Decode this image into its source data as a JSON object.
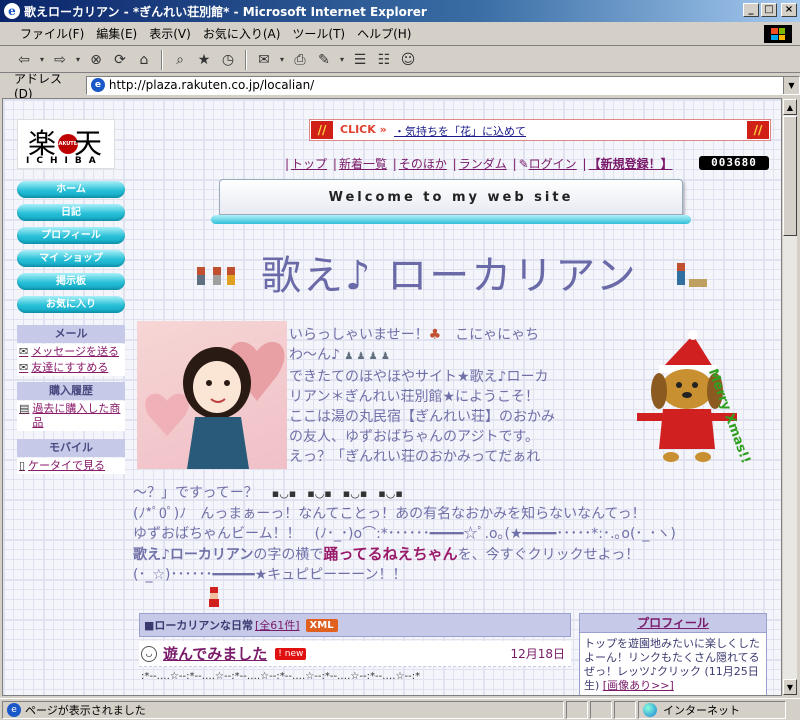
{
  "window": {
    "title": "歌えローカリアン - *ぎんれい荘別館* - Microsoft Internet Explorer"
  },
  "menubar": [
    "ファイル(F)",
    "編集(E)",
    "表示(V)",
    "お気に入り(A)",
    "ツール(T)",
    "ヘルプ(H)"
  ],
  "toolbar": {
    "icons": [
      "back-icon",
      "forward-icon",
      "stop-icon",
      "refresh-icon",
      "home-icon",
      "search-icon",
      "favorites-icon",
      "history-icon",
      "mail-icon",
      "print-icon",
      "edit-icon",
      "discuss-icon",
      "messenger-icon"
    ]
  },
  "address": {
    "label": "アドレス(D)",
    "url": "http://plaza.rakuten.co.jp/localian/"
  },
  "status": {
    "text": "ページが表示されました",
    "zone": "インターネット"
  },
  "page": {
    "logo": {
      "left": "楽",
      "right": "天",
      "dot": "RAKUTEN",
      "sub": "ICHIBA"
    },
    "nav_buttons": [
      "ホーム",
      "日記",
      "プロフィール",
      "マイ ショップ",
      "掲示板",
      "お気に入り"
    ],
    "sidebar": {
      "mail_head": "メール",
      "mail_links": [
        "メッセージを送る",
        "友達にすすめる"
      ],
      "history_head": "購入履歴",
      "history_link": "過去に購入した商品",
      "mobile_head": "モバイル",
      "mobile_link": "ケータイで見る"
    },
    "click_banner": {
      "label": "CLICK »",
      "link": "・気持ちを「花」に込めて"
    },
    "topnav": {
      "items": [
        "トップ",
        "新着一覧",
        "そのほか",
        "ランダム"
      ],
      "login": "ログイン",
      "register": "【新規登録！】",
      "counter": "003680"
    },
    "welcome": "Welcome to my web site",
    "main_title": "歌え♪ ローカリアン",
    "intro_top": [
      "いらっしゃいませー！",
      "こにゃにゃち",
      "わ～ん♪",
      "できたてのほやほやサイト★歌え♪ローカ",
      "リアン＊ぎんれい荘別館★にようこそ！",
      "ここは湯の丸民宿【ぎんれい荘】のおかみ",
      "の友人、ゆずおばちゃんのアジトです。",
      "えっ？「ぎんれい荘のおかみってだぁれ"
    ],
    "intro_bottom": {
      "line1": "～？」ですってー？",
      "line2": "(ﾉ*ﾟ0ﾟ)ﾉ　んっまぁーっ！なんてことっ！あの有名なおかみを知らないなんてっ！",
      "line3": "ゆずおばちゃんビーム！！　(ﾉ･_･)o⌒:*･･････━━━━☆ﾟ.o｡(★━━━━･････*:･.｡o(･_･ヽ)",
      "line4_a": "歌え♪ローカリアン",
      "line4_b": "の字の横で",
      "line4_c": "踊ってるねえちゃん",
      "line4_d": "を、今すぐクリックせよっ！",
      "line5": "(･_☆)･･････━━━━━★キュピピーーーン！！"
    },
    "dog_text": "Merry Xmas!!",
    "blog": {
      "title": "■ローカリアンな日常",
      "count": "[全61件]",
      "xml": "XML",
      "entry_title": "遊んでみました",
      "entry_badge": "new",
      "entry_date": "12月18日",
      "stars": ":*--‥‥☆--:*--‥‥☆--:*--‥‥☆--:*--‥‥☆--:*--‥‥☆--:*--‥‥☆--:*"
    },
    "profile": {
      "head": "プロフィール",
      "body": "トップを遊園地みたいに楽しくしたよーん！リンクもたくさん隠れてるぜっ！レッツ♪クリック (11月25日生)",
      "link": "[画像あり>>]"
    }
  }
}
